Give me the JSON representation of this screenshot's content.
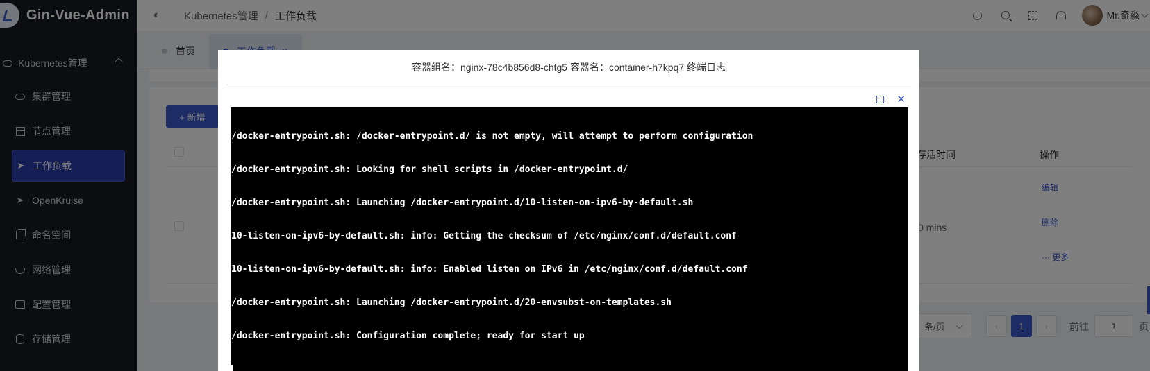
{
  "app": {
    "title": "Gin-Vue-Admin"
  },
  "sidebar": {
    "group_label": "Kubernetes管理",
    "items": [
      {
        "label": "集群管理",
        "icon": "cloud-icon"
      },
      {
        "label": "节点管理",
        "icon": "grid-icon"
      },
      {
        "label": "工作负载",
        "icon": "send-icon",
        "active": true
      },
      {
        "label": "OpenKruise",
        "icon": "send-icon"
      },
      {
        "label": "命名空间",
        "icon": "crop-icon"
      },
      {
        "label": "网络管理",
        "icon": "bowl-icon"
      },
      {
        "label": "配置管理",
        "icon": "document-icon"
      },
      {
        "label": "存储管理",
        "icon": "database-icon"
      }
    ]
  },
  "header": {
    "breadcrumb": [
      "Kubernetes管理",
      "工作负载"
    ],
    "breadcrumb_sep": "/",
    "username": "Mr.奇淼"
  },
  "tabs": [
    {
      "label": "首页"
    },
    {
      "label": "工作负载",
      "active": true
    }
  ],
  "main": {
    "add_button": "+ 新增",
    "col_live_time": "存活时间",
    "col_actions": "操作",
    "action_edit": "编辑",
    "action_delete": "删除",
    "action_more": "··· 更多",
    "cell_mins": "0 mins",
    "page_size": "条/页",
    "current_page": "1",
    "goto_label": "前往",
    "goto_value": "1",
    "page_unit": "页"
  },
  "dialog": {
    "title": "容器组名：nginx-78c4b856d8-chtg5 容器名：container-h7kpq7 终端日志",
    "log_lines": [
      "/docker-entrypoint.sh: /docker-entrypoint.d/ is not empty, will attempt to perform configuration",
      "/docker-entrypoint.sh: Looking for shell scripts in /docker-entrypoint.d/",
      "/docker-entrypoint.sh: Launching /docker-entrypoint.d/10-listen-on-ipv6-by-default.sh",
      "10-listen-on-ipv6-by-default.sh: info: Getting the checksum of /etc/nginx/conf.d/default.conf",
      "10-listen-on-ipv6-by-default.sh: info: Enabled listen on IPv6 in /etc/nginx/conf.d/default.conf",
      "/docker-entrypoint.sh: Launching /docker-entrypoint.d/20-envsubst-on-templates.sh",
      "/docker-entrypoint.sh: Configuration complete; ready for start up"
    ]
  },
  "colors": {
    "sidebar_bg": "#191a23",
    "accent": "#3a58c9",
    "terminal_bg": "#000000"
  }
}
